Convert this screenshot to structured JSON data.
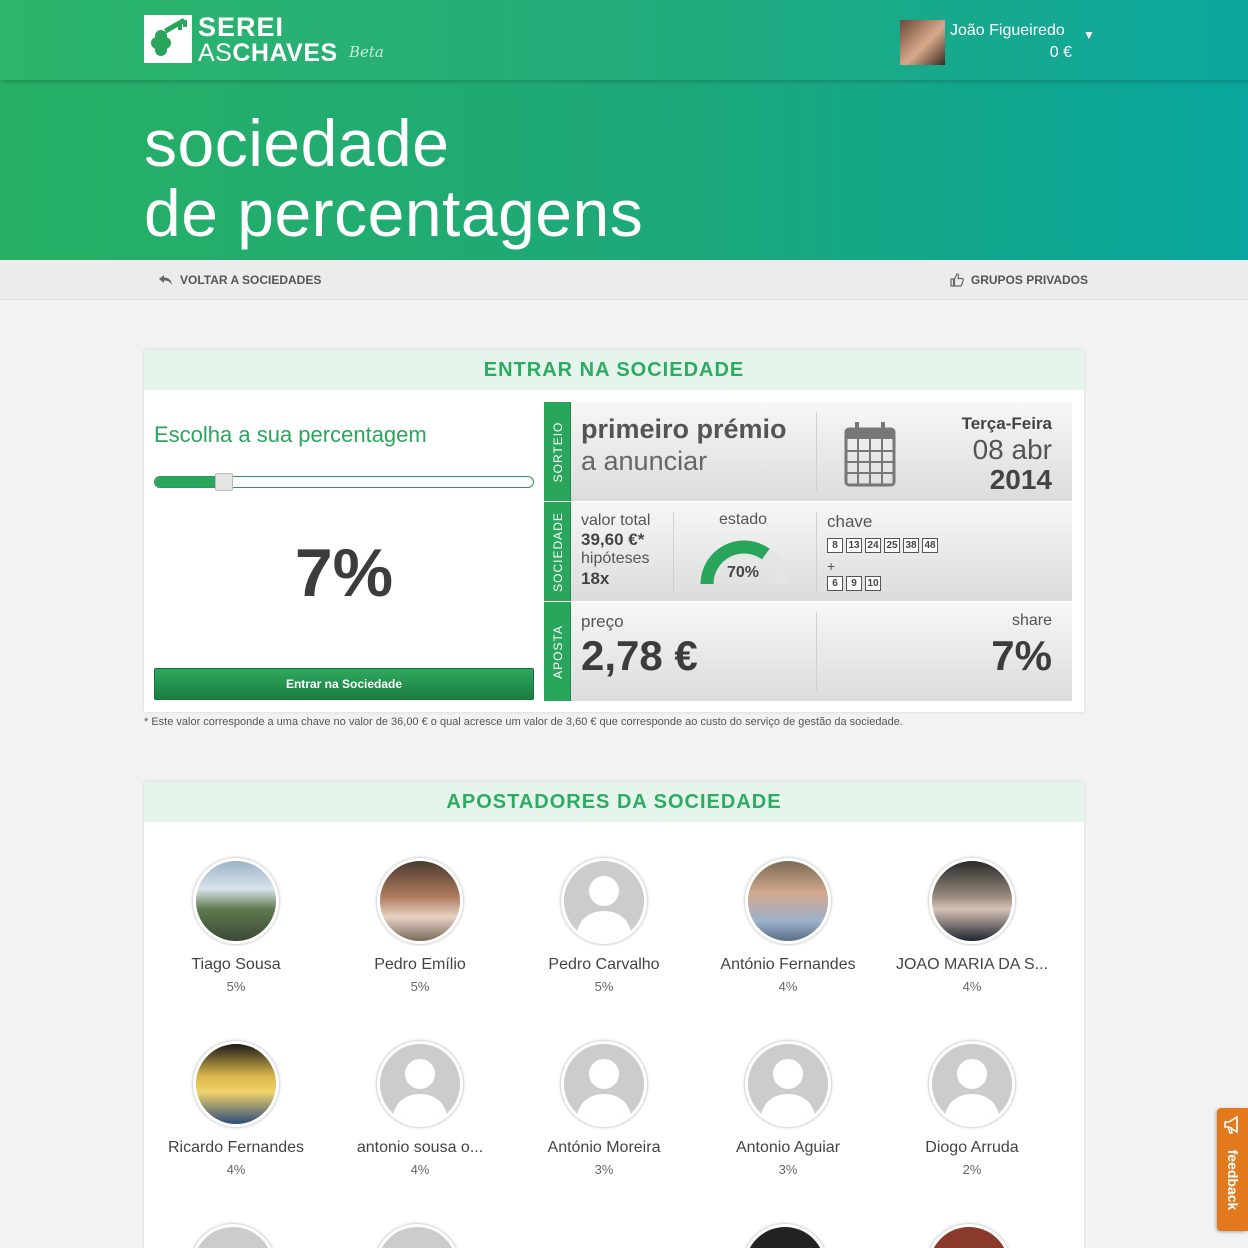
{
  "header": {
    "logo_line1": "SEREI",
    "logo_line2_a": "AS",
    "logo_line2_b": "CHAVES",
    "logo_beta": "Beta",
    "user_name": "João Figueiredo",
    "user_balance": "0 €"
  },
  "page": {
    "title_line1": "sociedade",
    "title_line2": "de percentagens"
  },
  "subnav": {
    "back_label": "VOLTAR A SOCIEDADES",
    "groups_label": "GRUPOS PRIVADOS"
  },
  "join": {
    "section_title": "ENTRAR NA SOCIEDADE",
    "choose_label": "Escolha a sua percentagem",
    "slider_value_percent": 7,
    "slider_max_percent": 40,
    "percent_display": "7%",
    "button_label": "Entrar na Sociedade"
  },
  "draw": {
    "tag": "SORTEIO",
    "prize_line1": "primeiro prémio",
    "prize_line2": "a anunciar",
    "day": "Terça-Feira",
    "date": "08 abr",
    "year": "2014"
  },
  "society": {
    "tag": "SOCIEDADE",
    "total_label": "valor total",
    "total_value": "39,60 €*",
    "hypotheses_label": "hipóteses",
    "hypotheses_value": "18x",
    "state_label": "estado",
    "state_value": "70%",
    "state_fraction": 0.7,
    "key_label": "chave",
    "numbers": [
      "8",
      "13",
      "24",
      "25",
      "38",
      "48"
    ],
    "plus": "+",
    "stars": [
      "6",
      "9",
      "10"
    ]
  },
  "bet": {
    "tag": "APOSTA",
    "price_label": "preço",
    "price_value": "2,78 €",
    "share_label": "share",
    "share_value": "7%"
  },
  "footnote": "* Este valor corresponde a uma chave no valor de 36,00 € o qual acresce um valor de 3,60 € que corresponde ao custo do serviço de gestão da sociedade.",
  "bettors": {
    "section_title": "APOSTADORES DA SOCIEDADE",
    "items": [
      {
        "name": "Tiago Sousa",
        "pct": "5%"
      },
      {
        "name": "Pedro Emílio",
        "pct": "5%"
      },
      {
        "name": "Pedro Carvalho",
        "pct": "5%"
      },
      {
        "name": "António Fernandes",
        "pct": "4%"
      },
      {
        "name": "JOAO MARIA DA S...",
        "pct": "4%"
      },
      {
        "name": "Ricardo Fernandes",
        "pct": "4%"
      },
      {
        "name": "antonio sousa o...",
        "pct": "4%"
      },
      {
        "name": "António Moreira",
        "pct": "3%"
      },
      {
        "name": "Antonio Aguiar",
        "pct": "3%"
      },
      {
        "name": "Diogo Arruda",
        "pct": "2%"
      }
    ]
  },
  "feedback_label": "feedback",
  "colors": {
    "brand_green": "#2aa55c",
    "brand_teal": "#08a69e",
    "feedback_orange": "#e27a1d"
  }
}
